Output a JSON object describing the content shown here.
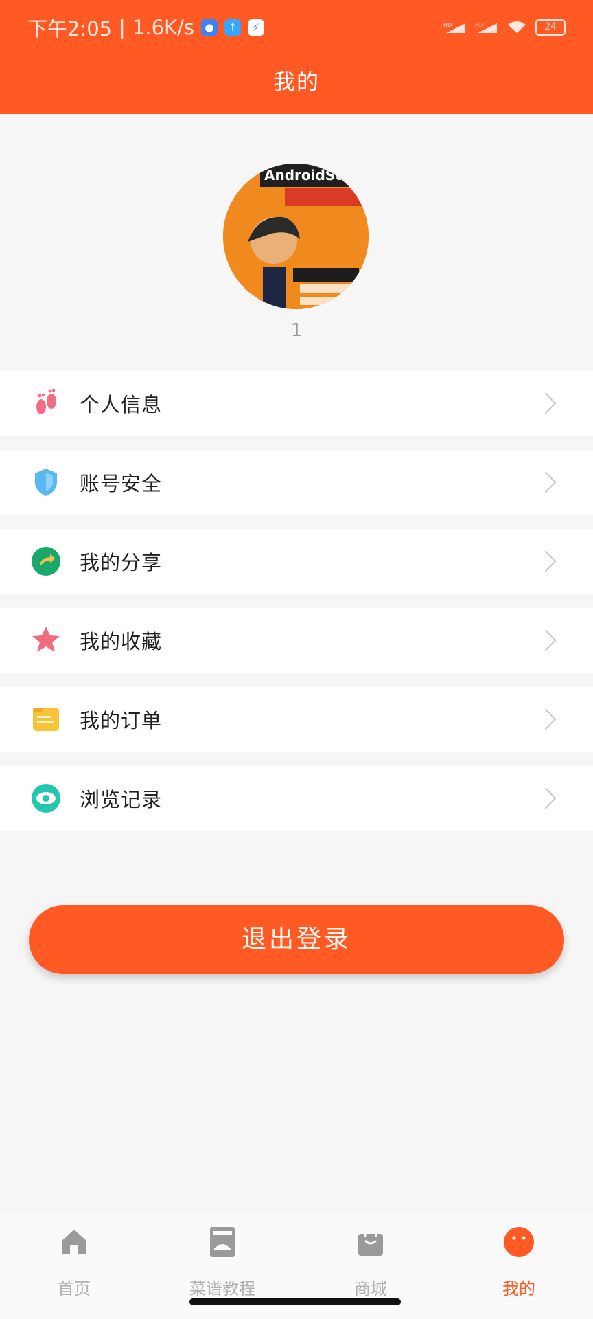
{
  "status_bar": {
    "time": "下午2:05",
    "net_speed": "1.6K/s",
    "battery": "24",
    "signal1": "HD",
    "signal2": "HD"
  },
  "header": {
    "title": "我的"
  },
  "profile": {
    "username": "1",
    "avatar_text": "AndroidStu"
  },
  "menu": [
    {
      "label": "个人信息",
      "icon": "footprints-icon"
    },
    {
      "label": "账号安全",
      "icon": "shield-icon"
    },
    {
      "label": "我的分享",
      "icon": "share-icon"
    },
    {
      "label": "我的收藏",
      "icon": "star-icon"
    },
    {
      "label": "我的订单",
      "icon": "order-icon"
    },
    {
      "label": "浏览记录",
      "icon": "eye-icon"
    }
  ],
  "logout_button": {
    "label": "退出登录"
  },
  "nav": [
    {
      "label": "首页",
      "icon": "home-icon"
    },
    {
      "label": "菜谱教程",
      "icon": "menu-book-icon"
    },
    {
      "label": "商城",
      "icon": "shopping-bag-icon"
    },
    {
      "label": "我的",
      "icon": "profile-icon"
    }
  ],
  "colors": {
    "accent": "#ff5a24",
    "text": "#222222",
    "muted": "#b0b0b0",
    "background": "#f6f6f6"
  }
}
